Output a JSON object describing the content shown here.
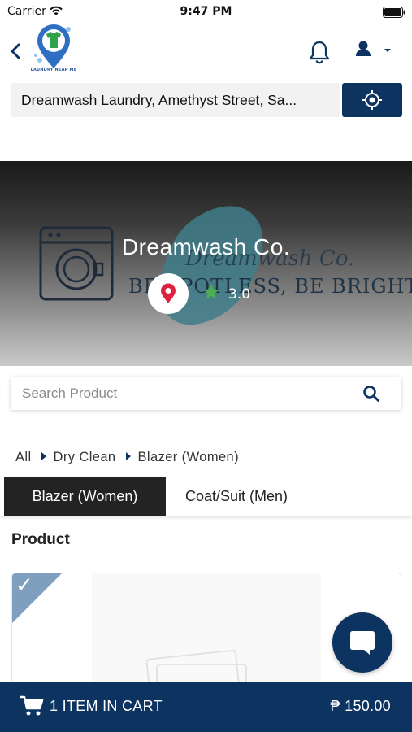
{
  "status_bar": {
    "carrier": "Carrier",
    "time": "9:47 PM"
  },
  "header": {
    "logo_text": "LAUNDRY NEAR ME",
    "icons": [
      "back-chevron-icon",
      "bell-icon",
      "user-icon",
      "caret-down-icon"
    ]
  },
  "location": {
    "address": "Dreamwash Laundry, Amethyst Street, Sa...",
    "locate_icon": "crosshair-icon"
  },
  "shop": {
    "name": "Dreamwash Co.",
    "rating": "3.0",
    "banner_text": "BE SPOTLESS, BE BRIGHT",
    "banner_script": "Dreamwash Co."
  },
  "search": {
    "placeholder": "Search Product"
  },
  "breadcrumb": {
    "items": [
      "All",
      "Dry Clean",
      "Blazer (Women)"
    ]
  },
  "tabs": {
    "items": [
      "Blazer (Women)",
      "Coat/Suit (Men)"
    ],
    "active": "Blazer (Women)"
  },
  "product": {
    "heading": "Product",
    "selected_mark": "✓"
  },
  "cart": {
    "count_label": "1 ITEM  IN CART",
    "total": "₱ 150.00"
  },
  "colors": {
    "primary": "#0d3460",
    "active_tab": "#232323",
    "star": "#4caf50",
    "pin": "#e0203f",
    "check_corner": "#7f9fbe"
  }
}
